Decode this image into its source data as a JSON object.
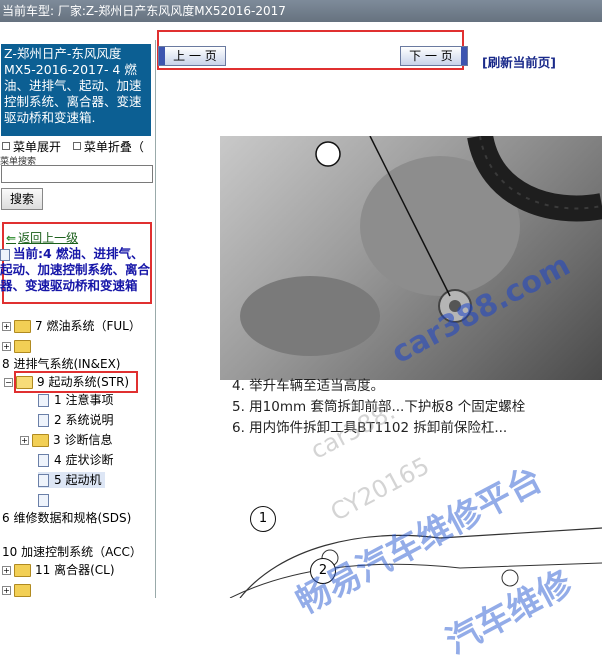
{
  "header": {
    "text": "当前车型:  厂家:Z-郑州日产东风风度MX52016-2017"
  },
  "sidebar": {
    "title": "Z-郑州日产-东风风度MX5-2016-2017- 4 燃油、进排气、起动、加速控制系统、离合器、变速驱动桥和变速箱.",
    "expand_label": "菜单展开",
    "collapse_label": "菜单折叠（",
    "search_caption": "菜单搜索",
    "search_value": "",
    "search_button": "搜索",
    "back_link": "返回上一级",
    "current_text": "当前:4 燃油、进排气、起动、加速控制系统、离合器、变速驱动桥和变速箱",
    "tree": [
      {
        "label": "7 燃油系统（FUL）"
      },
      {
        "label": ""
      },
      {
        "label": "8 进排气系统(IN&EX)"
      },
      {
        "label": "9 起动系统(STR)"
      },
      {
        "label": "1 注意事项"
      },
      {
        "label": "2 系统说明"
      },
      {
        "label": "3 诊断信息"
      },
      {
        "label": "4 症状诊断"
      },
      {
        "label": "5 起动机"
      },
      {
        "label": ""
      },
      {
        "label": "6 维修数据和规格(SDS)"
      },
      {
        "label": "10 加速控制系统（ACC）"
      },
      {
        "label": "11 离合器(CL)"
      },
      {
        "label": ""
      }
    ]
  },
  "content": {
    "prev_button": "上 一 页",
    "next_button": "下 一 页",
    "refresh_link": "[刷新当前页]",
    "steps": [
      "4. 举升车辆至适当高度。",
      "5. 用10mm 套筒拆卸前部...下护板8 个固定螺栓",
      "6. 用内饰件拆卸工具BT1102 拆卸前保险杠..."
    ],
    "diagram_labels": [
      "1",
      "2"
    ]
  },
  "watermarks": {
    "site": "car388.com",
    "site2": "car388.",
    "code": "CY20165",
    "brand": "畅易汽车维修平台",
    "brand2": "汽车维修"
  }
}
